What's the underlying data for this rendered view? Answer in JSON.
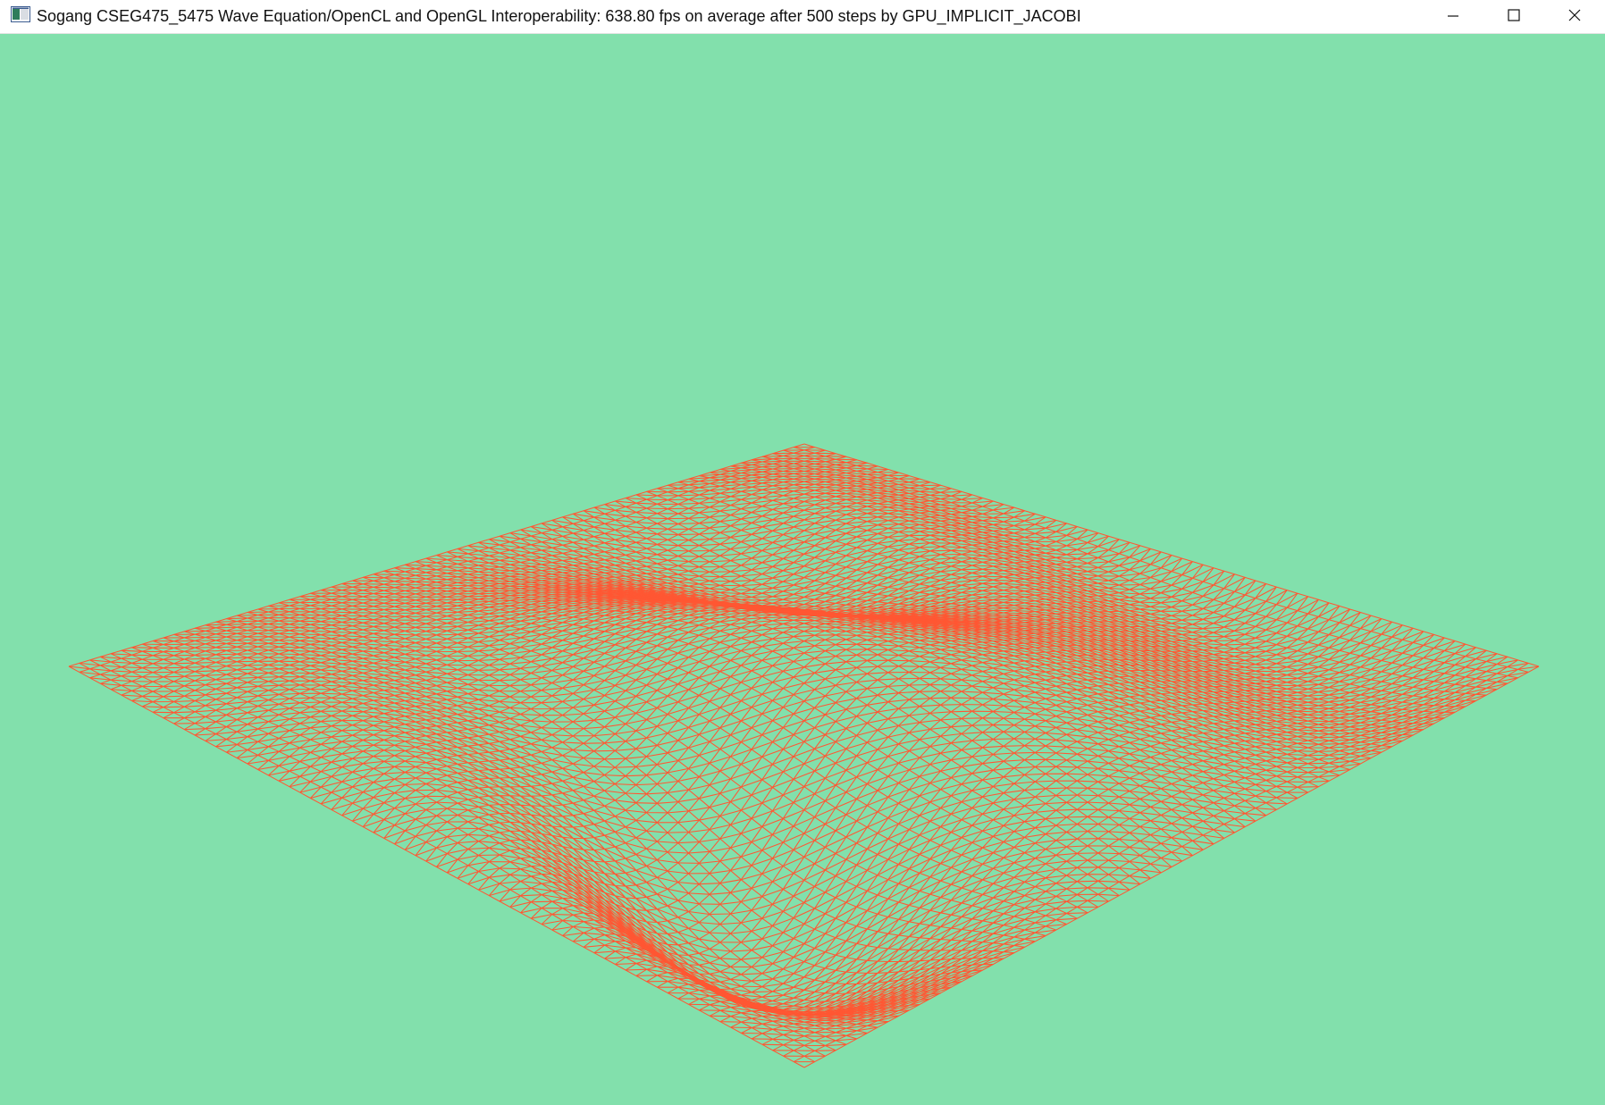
{
  "window": {
    "title": "Sogang CSEG475_5475 Wave Equation/OpenCL and OpenGL Interoperability: 638.80 fps on average after 500 steps by GPU_IMPLICIT_JACOBI",
    "app_icon": "opengl-window-icon",
    "controls": {
      "minimize_icon": "minimize-icon",
      "maximize_icon": "maximize-icon",
      "close_icon": "close-icon"
    }
  },
  "scene": {
    "background_color": "#82e0ac",
    "mesh_color": "#ff5733",
    "render_mode": "wireframe",
    "surface": "wave-equation-height-field"
  }
}
